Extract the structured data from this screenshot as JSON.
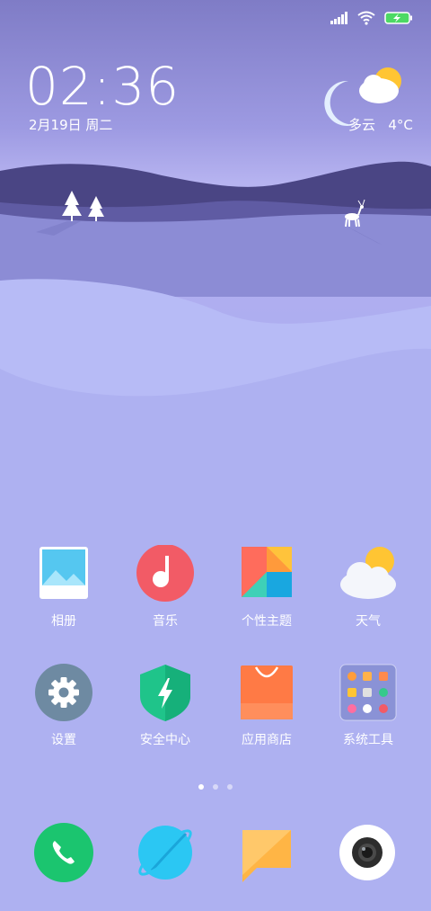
{
  "status_bar": {
    "signal_icon": "signal-icon",
    "wifi_icon": "wifi-icon",
    "battery_icon": "battery-charging-icon"
  },
  "lock_widget": {
    "time": "02:36",
    "date": "2月19日 周二",
    "weather": "多云",
    "temperature": "4°C"
  },
  "apps": [
    {
      "label": "相册",
      "icon": "gallery-icon"
    },
    {
      "label": "音乐",
      "icon": "music-icon"
    },
    {
      "label": "个性主题",
      "icon": "themes-icon"
    },
    {
      "label": "天气",
      "icon": "weather-icon"
    },
    {
      "label": "设置",
      "icon": "settings-icon"
    },
    {
      "label": "安全中心",
      "icon": "security-icon"
    },
    {
      "label": "应用商店",
      "icon": "app-store-icon"
    },
    {
      "label": "系统工具",
      "icon": "folder-icon"
    }
  ],
  "page_indicator": {
    "pages": 3,
    "active": 1
  },
  "dock": [
    {
      "icon": "phone-icon"
    },
    {
      "icon": "browser-icon"
    },
    {
      "icon": "messages-icon"
    },
    {
      "icon": "camera-icon"
    }
  ],
  "colors": {
    "music": "#f25b66",
    "security": "#1fc48a",
    "store": "#ff7a45",
    "phone": "#1bc56f",
    "browser": "#2bc7f3",
    "messages": "#ffb545",
    "settings": "#6e8aa2"
  }
}
